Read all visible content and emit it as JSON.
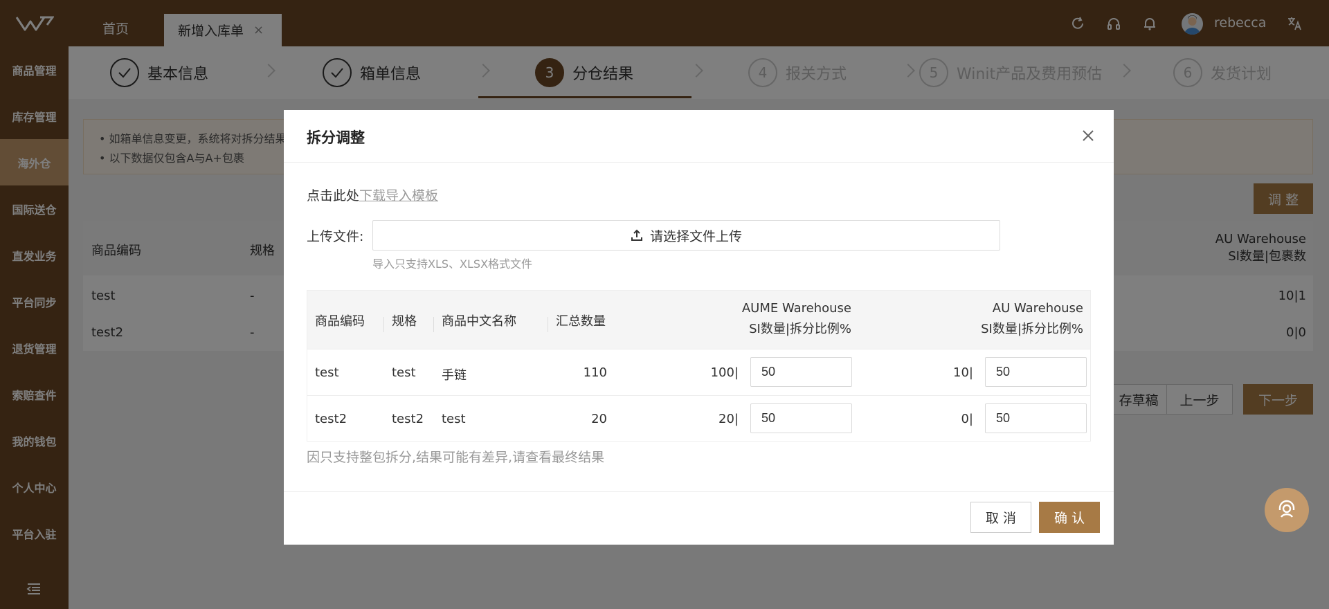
{
  "header": {
    "home_tab": "首页",
    "active_tab": "新增入库单",
    "active_tab_close": "×",
    "username": "rebecca",
    "icons": [
      "refresh-icon",
      "headset-icon",
      "bell-icon",
      "translate-icon"
    ]
  },
  "sidebar": {
    "items": [
      "商品管理",
      "库存管理",
      "海外仓",
      "国际送仓",
      "直发业务",
      "平台同步",
      "退货管理",
      "索赔查件",
      "我的钱包",
      "个人中心",
      "平台入驻"
    ],
    "active": "海外仓"
  },
  "steps": [
    {
      "num": "1",
      "label": "基本信息",
      "state": "done"
    },
    {
      "num": "2",
      "label": "箱单信息",
      "state": "done"
    },
    {
      "num": "3",
      "label": "分仓结果",
      "state": "current"
    },
    {
      "num": "4",
      "label": "报关方式",
      "state": "todo"
    },
    {
      "num": "5",
      "label": "Winit产品及费用预估",
      "state": "todo"
    },
    {
      "num": "6",
      "label": "发货计划",
      "state": "todo"
    }
  ],
  "background": {
    "notice_1": "• 如箱单信息变更，系统将对拆分结果",
    "notice_2": "• 以下数据仅包含A与A+包裹",
    "adjust_button": "调 整",
    "table_headers": {
      "code": "商品编码",
      "spec": "规格",
      "au_line1": "AU Warehouse",
      "au_line2": "SI数量|包裹数"
    },
    "rows": [
      {
        "code": "test",
        "spec": "-",
        "au": "10|1"
      },
      {
        "code": "test2",
        "spec": "-",
        "au": "0|0"
      }
    ],
    "buttons": {
      "draft": "存草稿",
      "prev": "上一步",
      "next": "下一步"
    }
  },
  "modal": {
    "title": "拆分调整",
    "download_prefix": "点击此处",
    "download_link": "下载导入模板",
    "upload_label": "上传文件:",
    "upload_button": "请选择文件上传",
    "upload_hint": "导入只支持XLS、XLSX格式文件",
    "table": {
      "headers": {
        "code": "商品编码",
        "spec": "规格",
        "name_cn": "商品中文名称",
        "total": "汇总数量",
        "aume_line1": "AUME Warehouse",
        "aume_line2": "SI数量|拆分比例%",
        "au_line1": "AU Warehouse",
        "au_line2": "SI数量|拆分比例%"
      },
      "rows": [
        {
          "code": "test",
          "spec": "test",
          "name_cn": "手链",
          "total": "110",
          "aume_qty": "100|",
          "aume_ratio": "50",
          "au_qty": "10|",
          "au_ratio": "50"
        },
        {
          "code": "test2",
          "spec": "test2",
          "name_cn": "test",
          "total": "20",
          "aume_qty": "20|",
          "aume_ratio": "50",
          "au_qty": "0|",
          "au_ratio": "50"
        }
      ]
    },
    "note": "因只支持整包拆分,结果可能有差异,请查看最终结果",
    "cancel": "取 消",
    "confirm": "确 认"
  },
  "colors": {
    "brand": "#6b4724",
    "accent": "#a77a45",
    "sidebar_active": "#c49a6c"
  }
}
